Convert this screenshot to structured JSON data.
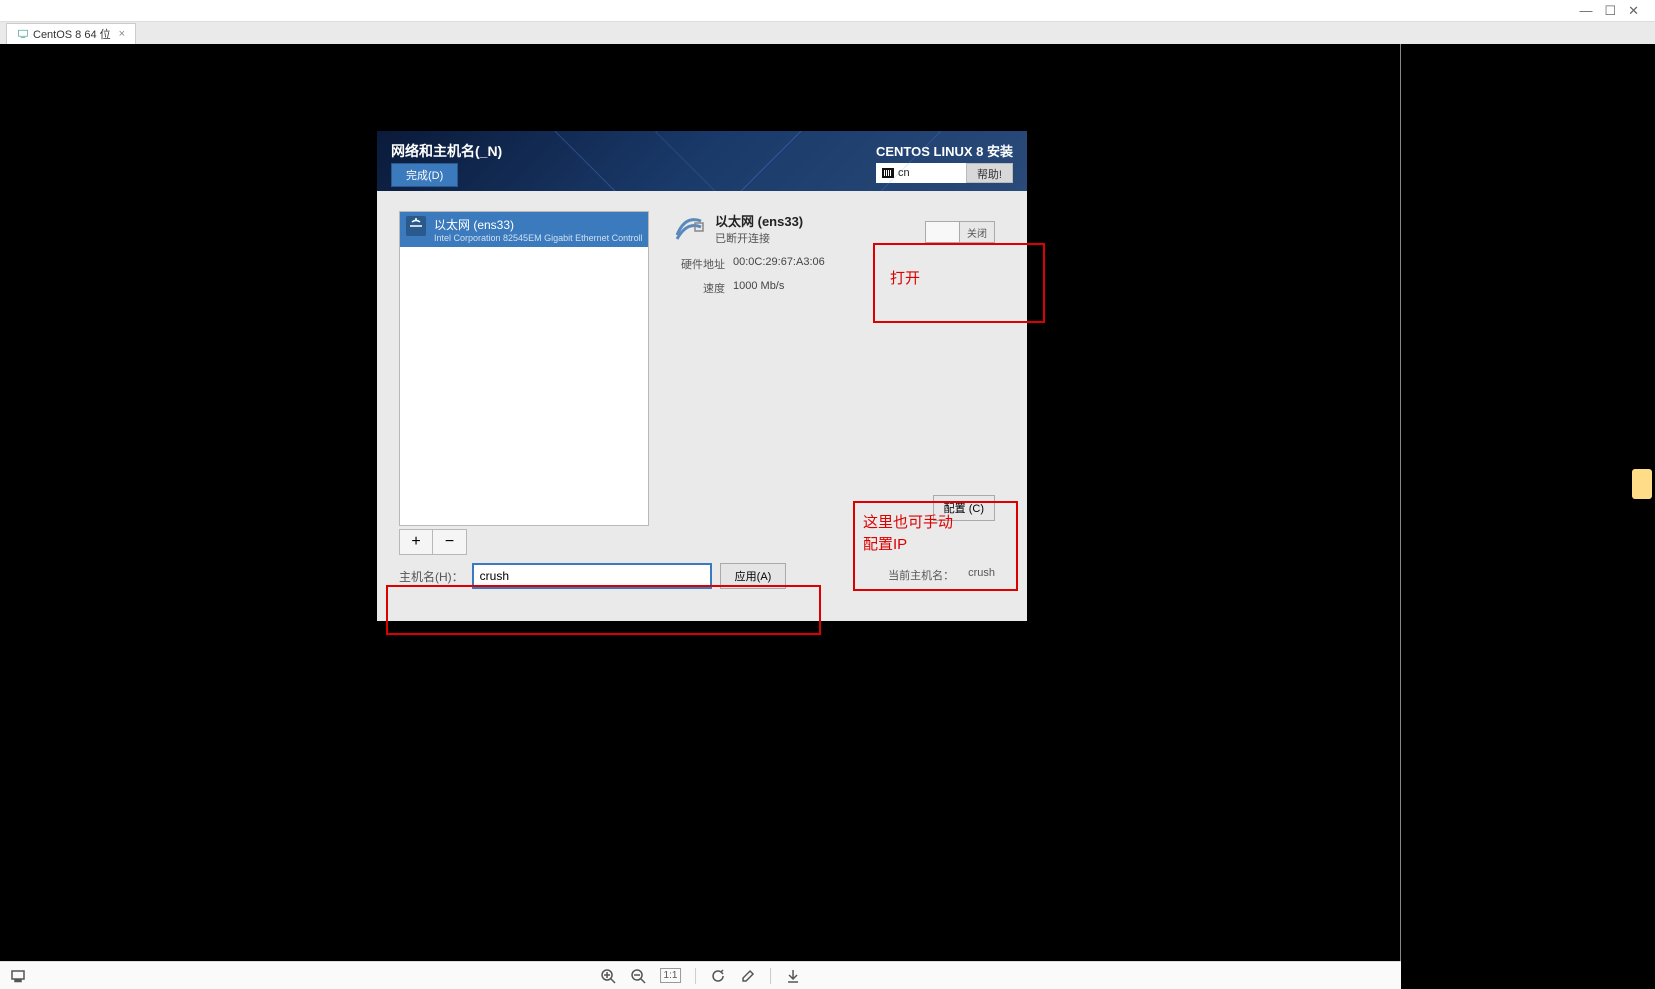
{
  "outer_window": {
    "minimize": "―",
    "maximize": "☐",
    "close": "✕"
  },
  "tab": {
    "label": "CentOS 8 64 位",
    "close": "×"
  },
  "installer": {
    "header_title": "网络和主机名(_N)",
    "done_label": "完成(D)",
    "product": "CENTOS LINUX 8 安装",
    "keyboard_layout": "cn",
    "help_label": "帮助!"
  },
  "device": {
    "title": "以太网 (ens33)",
    "subtitle": "Intel Corporation 82545EM Gigabit Ethernet Controller (…"
  },
  "plus": "+",
  "minus": "−",
  "details": {
    "title": "以太网 (ens33)",
    "status": "已断开连接",
    "hw_label": "硬件地址",
    "hw_value": "00:0C:29:67:A3:06",
    "speed_label": "速度",
    "speed_value": "1000 Mb/s"
  },
  "toggle": {
    "off_label": "关闭"
  },
  "configure_label": "配置 (C)",
  "hostname": {
    "label": "主机名(H)：",
    "value": "crush",
    "apply_label": "应用(A)",
    "current_label": "当前主机名：",
    "current_value": "crush"
  },
  "annotations": {
    "open": "打开",
    "manual_ip_line1": "这里也可手动",
    "manual_ip_line2": "配置IP"
  },
  "toolbar": {
    "fit": "1:1"
  }
}
